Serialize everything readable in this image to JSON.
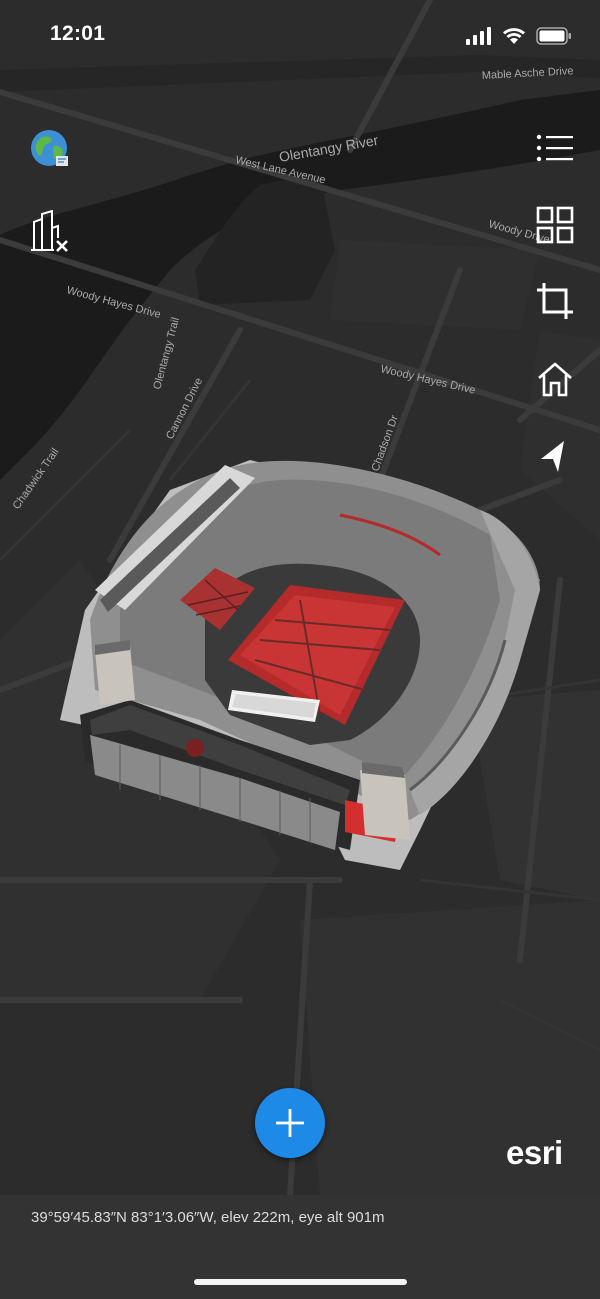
{
  "status_bar": {
    "time": "12:01"
  },
  "map": {
    "streets": {
      "mable": "Mable Asche Drive",
      "olentangy_river": "Olentangy River",
      "west_lane": "West Lane Avenue",
      "woody_w": "Woody Hayes Drive",
      "woody_e": "Woody Hayes Drive",
      "olentangy_trail": "Olentangy Trail",
      "cannon": "Cannon Drive",
      "chadwick": "Chadwick Trail",
      "chadson": "Chadson Dr",
      "woody_drive_ne": "Woody Drive"
    }
  },
  "toolbar": {
    "left": [
      {
        "name": "basemap",
        "icon": "globe-icon"
      },
      {
        "name": "buildings",
        "icon": "buildings-toggle-icon"
      }
    ],
    "right": [
      {
        "name": "layers",
        "icon": "list-icon"
      },
      {
        "name": "gallery",
        "icon": "grid-icon"
      },
      {
        "name": "crop",
        "icon": "crop-icon"
      },
      {
        "name": "home",
        "icon": "home-icon"
      },
      {
        "name": "location",
        "icon": "navigation-arrow-icon"
      }
    ]
  },
  "fab": {
    "icon": "plus-icon"
  },
  "branding": {
    "logo": "esri"
  },
  "coordinates": {
    "text": "39°59′45.83″N 83°1′3.06″W, elev 222m, eye alt 901m"
  },
  "colors": {
    "accent": "#1e8ae8",
    "map_background": "#2b2b2b",
    "coord_bar": "#333333",
    "stadium_red": "#b52a2a"
  }
}
